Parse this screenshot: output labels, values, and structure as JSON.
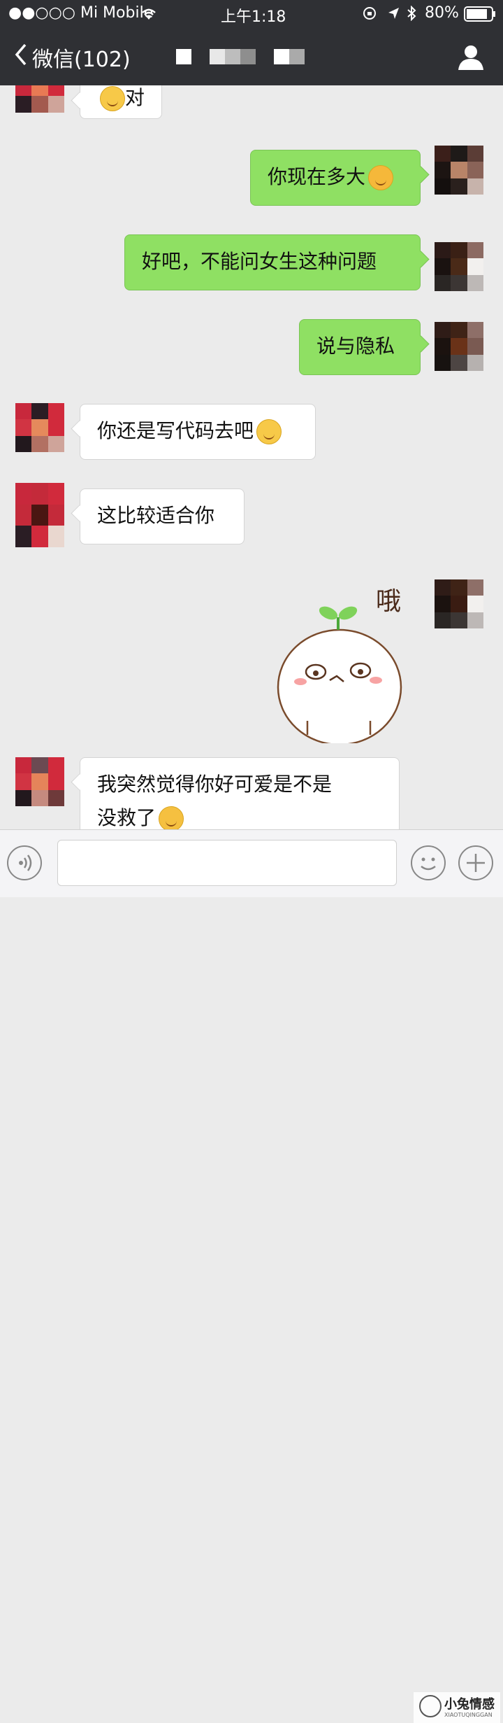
{
  "status_bar": {
    "carrier": "●●○○○ Mi Mobile",
    "time": "上午1:18",
    "battery": "80%"
  },
  "nav": {
    "back_label": "微信(102)"
  },
  "messages": [
    {
      "side": "left",
      "text": "对",
      "emoji": "smile"
    },
    {
      "side": "right",
      "text": "你现在多大",
      "emoji": "heart-eyes"
    },
    {
      "side": "right",
      "text": "好吧，不能问女生这种问题"
    },
    {
      "side": "right",
      "text": "说与隐私"
    },
    {
      "side": "left",
      "text": "你还是写代码去吧",
      "emoji": "thinking"
    },
    {
      "side": "left",
      "text": "这比较适合你"
    },
    {
      "side": "right",
      "sticker_text": "哦"
    },
    {
      "side": "left",
      "text_line1": "我突然觉得你好可爱是不是",
      "text_line2": "没救了",
      "emoji": "laugh-cry"
    }
  ],
  "watermark": {
    "text": "小兔情感",
    "subtext": "XIAOTUQINGGAN"
  },
  "icons": [
    "back-chevron-icon",
    "wifi-icon",
    "location-icon",
    "bluetooth-icon",
    "battery-icon",
    "profile-icon",
    "voice-icon",
    "emoji-icon",
    "plus-icon"
  ],
  "colors": {
    "nav_bg": "#2f3034",
    "chat_bg": "#ebebeb",
    "bubble_sent": "#8fe063",
    "bubble_received": "#ffffff"
  }
}
